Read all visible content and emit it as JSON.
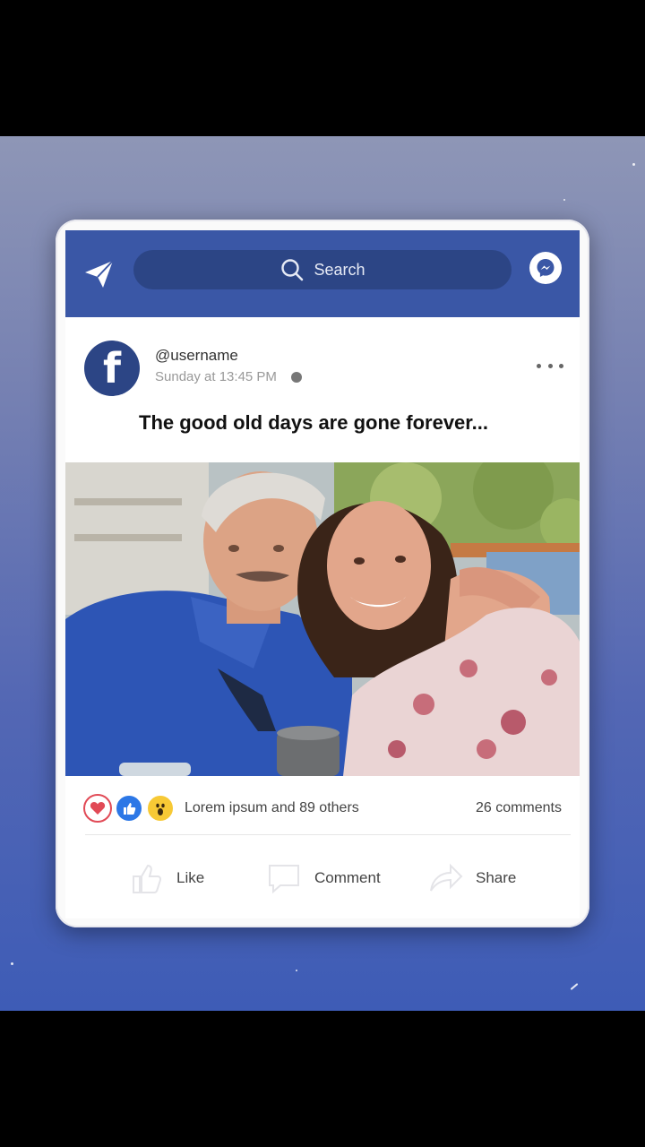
{
  "app": {
    "name": "Facebook"
  },
  "topbar": {
    "search_label": "Search",
    "icons": [
      "send-icon",
      "search-icon",
      "messenger-icon"
    ],
    "color": "#3a57a6"
  },
  "post": {
    "avatar_icon": "facebook-logo-icon",
    "username": "@username",
    "timestamp": "Sunday at 13:45 PM",
    "caption": "The good old days are gone forever..."
  },
  "stats": {
    "reactions": [
      "love-icon",
      "like-icon",
      "wow-icon"
    ],
    "reaction_text": "Lorem ipsum and  89 others",
    "comments": "26 comments"
  },
  "actions": {
    "like": "Like",
    "comment": "Comment",
    "share": "Share"
  }
}
